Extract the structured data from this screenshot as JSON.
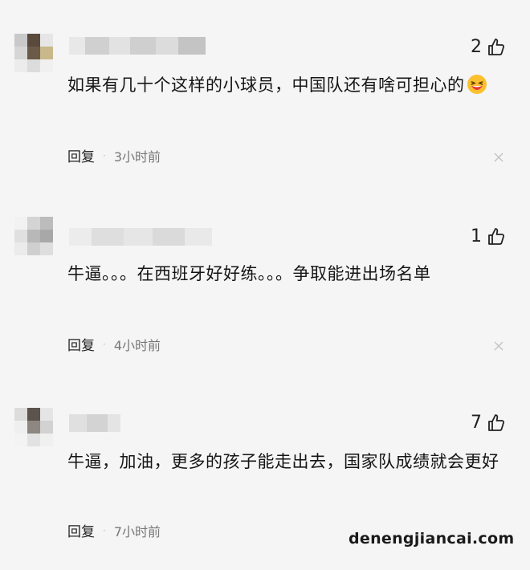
{
  "comments": [
    {
      "likes": "2",
      "text": "如果有几十个这样的小球员，中国队还有啥可担心的",
      "emoji": "grinning-squint-emoji",
      "reply_label": "回复",
      "separator": "·",
      "time": "3小时前"
    },
    {
      "likes": "1",
      "text": "牛逼。。。在西班牙好好练。。。争取能进出场名单",
      "reply_label": "回复",
      "separator": "·",
      "time": "4小时前"
    },
    {
      "likes": "7",
      "text": "牛逼，加油，更多的孩子能走出去，国家队成绩就会更好",
      "reply_label": "回复",
      "separator": "·",
      "time": "7小时前"
    }
  ],
  "watermark": "denengjiancai.com",
  "colors": {
    "background": "#f5f5f5",
    "text": "#151515",
    "time": "#777777"
  },
  "icons": {
    "like": "thumbs-up-icon",
    "dismiss": "close-icon"
  }
}
